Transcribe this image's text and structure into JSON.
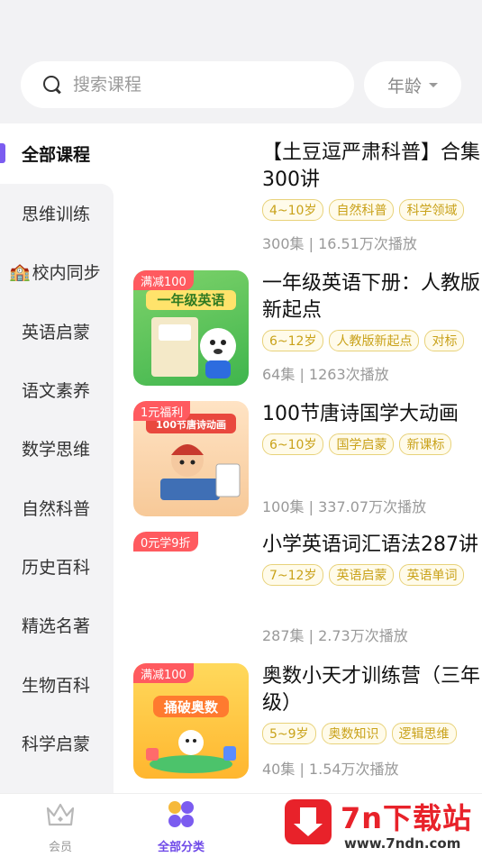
{
  "search": {
    "placeholder": "搜索课程"
  },
  "age_filter": {
    "label": "年龄"
  },
  "sidebar": {
    "active": "全部课程",
    "items": [
      {
        "label": "思维训练"
      },
      {
        "label": "校内同步",
        "emoji": "🏫"
      },
      {
        "label": "英语启蒙"
      },
      {
        "label": "语文素养"
      },
      {
        "label": "数学思维"
      },
      {
        "label": "自然科普"
      },
      {
        "label": "历史百科"
      },
      {
        "label": "精选名著"
      },
      {
        "label": "生物百科"
      },
      {
        "label": "科学启蒙"
      }
    ]
  },
  "courses": [
    {
      "title": "【土豆逗严肃科普】合集300讲",
      "tags": [
        "4~10岁",
        "自然科普",
        "科学领域"
      ],
      "stats": "300集 | 16.51万次播放"
    },
    {
      "badge": "满减100",
      "thumb_title": "一年级英语",
      "title": "一年级英语下册：人教版新起点",
      "tags": [
        "6~12岁",
        "人教版新起点",
        "对标"
      ],
      "stats": "64集 | 1263次播放"
    },
    {
      "badge": "1元福利",
      "thumb_title": "100节唐诗动画",
      "title": "100节唐诗国学大动画",
      "tags": [
        "6~10岁",
        "国学启蒙",
        "新课标"
      ],
      "stats": "100集 | 337.07万次播放"
    },
    {
      "badge": "0元学9折",
      "title": "小学英语词汇语法287讲",
      "tags": [
        "7~12岁",
        "英语启蒙",
        "英语单词"
      ],
      "stats": "287集 | 2.73万次播放"
    },
    {
      "badge": "满减100",
      "thumb_title": "捅破奥数",
      "title": "奥数小天才训练营（三年级）",
      "tags": [
        "5~9岁",
        "奥数知识",
        "逻辑思维"
      ],
      "stats": "40集 | 1.54万次播放"
    }
  ],
  "tabbar": {
    "member": "会员",
    "category": "全部分类"
  },
  "watermark": {
    "name": "7n下载站",
    "url": "www.7ndn.com"
  },
  "colors": {
    "accent": "#6f49e8",
    "tag": "#c9a21a",
    "badge": "#ff5a5f"
  }
}
